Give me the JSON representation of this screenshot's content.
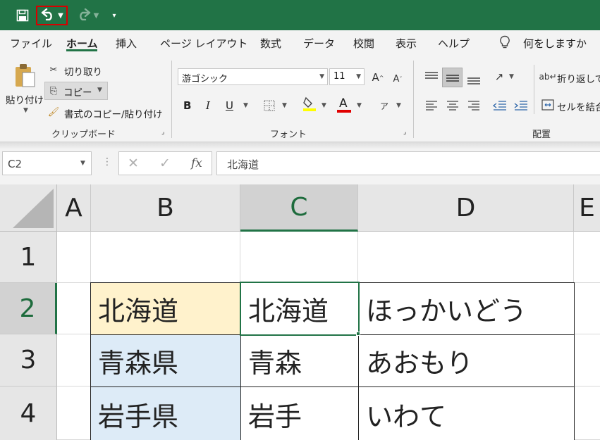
{
  "qat": {
    "save_icon": "save-icon",
    "undo_icon": "undo-icon",
    "redo_icon": "redo-icon",
    "customize_icon": "customize-qat-icon",
    "highlight_color": "#d80000",
    "bar_color": "#217346"
  },
  "tabs": [
    {
      "label": "ファイル"
    },
    {
      "label": "ホーム",
      "active": true
    },
    {
      "label": "挿入"
    },
    {
      "label": "ページ レイアウト"
    },
    {
      "label": "数式"
    },
    {
      "label": "データ"
    },
    {
      "label": "校閲"
    },
    {
      "label": "表示"
    },
    {
      "label": "ヘルプ"
    }
  ],
  "tell_me": {
    "icon": "lightbulb-icon",
    "label": "何をしますか"
  },
  "clipboard": {
    "paste": "貼り付け",
    "cut": "切り取り",
    "copy": "コピー",
    "format_painter": "書式のコピー/貼り付け",
    "group": "クリップボード"
  },
  "font": {
    "name": "游ゴシック",
    "size": "11",
    "bold": "B",
    "italic": "I",
    "underline": "U",
    "font_color_letter": "A",
    "group": "フォント",
    "fill_color": "#ffff00",
    "font_color": "#e00000"
  },
  "alignment": {
    "wrap": "折り返して",
    "merge": "セルを結合",
    "group": "配置"
  },
  "formula_bar": {
    "name_box": "C2",
    "fx": "fx",
    "value": "北海道"
  },
  "columns": [
    "A",
    "B",
    "C",
    "D",
    "E"
  ],
  "rows": [
    "1",
    "2",
    "3",
    "4"
  ],
  "cells": {
    "B2": "北海道",
    "C2": "北海道",
    "D2": "ほっかいどう",
    "B3": "青森県",
    "C3": "青森",
    "D3": "あおもり",
    "B4": "岩手県",
    "C4": "岩手",
    "D4": "いわて"
  },
  "colors": {
    "b2_fill": "#fff2cc",
    "b_fill": "#ddebf7",
    "selection": "#217346"
  }
}
